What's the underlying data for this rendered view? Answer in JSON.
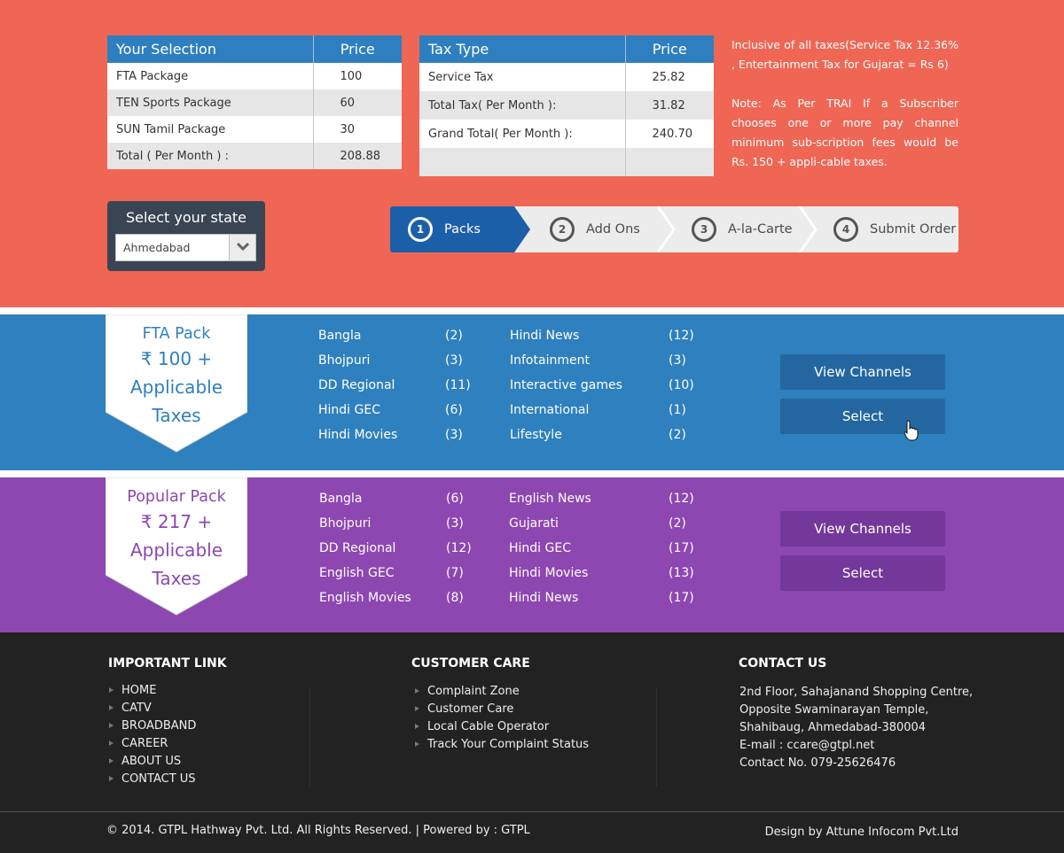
{
  "selection_table": {
    "headers": [
      "Your Selection",
      "Price"
    ],
    "rows": [
      [
        "FTA Package",
        "100"
      ],
      [
        "TEN Sports Package",
        "60"
      ],
      [
        "SUN Tamil Package",
        "30"
      ],
      [
        "Total ( Per Month ) :",
        "208.88"
      ]
    ]
  },
  "tax_table": {
    "headers": [
      "Tax Type",
      "Price"
    ],
    "rows": [
      [
        "Service Tax",
        "25.82"
      ],
      [
        "Total Tax( Per Month ):",
        "31.82"
      ],
      [
        "Grand Total( Per Month ):",
        "240.70"
      ],
      [
        "",
        ""
      ]
    ]
  },
  "note": {
    "line1": "Inclusive of all taxes(Service Tax 12.36% , Entertainment Tax for Gujarat = Rs 6)",
    "line2": "Note: As Per TRAI If a Subscriber chooses one or more pay channel minimum sub-scription fees would be Rs. 150 + appli-cable taxes."
  },
  "state": {
    "title": "Select your state",
    "selected": "Ahmedabad"
  },
  "steps": [
    {
      "num": "1",
      "label": "Packs"
    },
    {
      "num": "2",
      "label": "Add Ons"
    },
    {
      "num": "3",
      "label": "A-la-Carte"
    },
    {
      "num": "4",
      "label": "Submit Order"
    }
  ],
  "packs": [
    {
      "name": "FTA Pack",
      "price": "₹ 100 +",
      "price2": "Applicable",
      "price3": "Taxes",
      "col1": [
        [
          "Bangla",
          "(2)"
        ],
        [
          "Bhojpuri",
          "(3)"
        ],
        [
          "DD Regional",
          "(11)"
        ],
        [
          "Hindi GEC",
          "(6)"
        ],
        [
          "Hindi Movies",
          "(3)"
        ]
      ],
      "col2": [
        [
          "Hindi News",
          "(12)"
        ],
        [
          "Infotainment",
          "(3)"
        ],
        [
          "Interactive games",
          "(10)"
        ],
        [
          "International",
          "(1)"
        ],
        [
          "Lifestyle",
          "(2)"
        ]
      ],
      "view_label": "View Channels",
      "select_label": "Select"
    },
    {
      "name": "Popular Pack",
      "price": "₹ 217 +",
      "price2": "Applicable",
      "price3": "Taxes",
      "col1": [
        [
          "Bangla",
          "(6)"
        ],
        [
          "Bhojpuri",
          "(3)"
        ],
        [
          "DD Regional",
          "(12)"
        ],
        [
          "English GEC",
          "(7)"
        ],
        [
          "English Movies",
          "(8)"
        ]
      ],
      "col2": [
        [
          "English News",
          "(12)"
        ],
        [
          "Gujarati",
          "(2)"
        ],
        [
          "Hindi GEC",
          "(17)"
        ],
        [
          "Hindi Movies",
          "(13)"
        ],
        [
          "Hindi News",
          "(17)"
        ]
      ],
      "view_label": "View Channels",
      "select_label": "Select"
    }
  ],
  "footer": {
    "important": {
      "title": "IMPORTANT LINK",
      "items": [
        "HOME",
        "CATV",
        "BROADBAND",
        "CAREER",
        "ABOUT US",
        "CONTACT US"
      ]
    },
    "care": {
      "title": "CUSTOMER CARE",
      "items": [
        "Complaint Zone",
        "Customer Care",
        "Local Cable Operator",
        "Track Your Complaint Status"
      ]
    },
    "contact": {
      "title": "CONTACT US",
      "lines": [
        "2nd Floor, Sahajanand Shopping Centre,",
        "Opposite Swaminarayan Temple,",
        "Shahibaug, Ahmedabad-380004",
        "E-mail :  ccare@gtpl.net",
        "Contact No. 079-25626476"
      ]
    },
    "copyright": "© 2014. GTPL Hathway Pvt. Ltd. All Rights Reserved. | Powered by : GTPL",
    "design": "Design by Attune Infocom Pvt.Ltd"
  },
  "colors": {
    "hero": "#ef6655",
    "fta": "#2e80be",
    "popular": "#8d47b1",
    "footer": "#222222",
    "step_active": "#1c5fa9"
  }
}
